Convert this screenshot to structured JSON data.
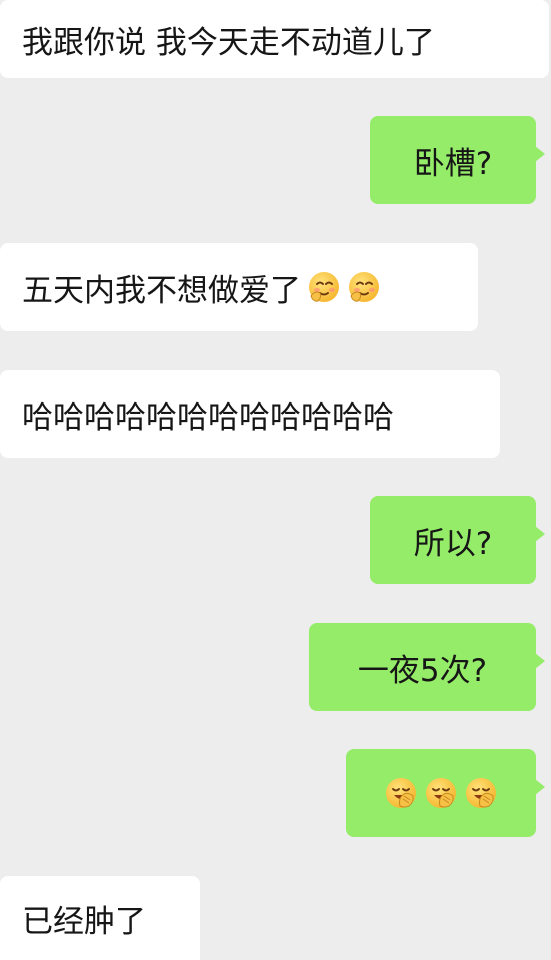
{
  "chat": {
    "messages": [
      {
        "side": "in",
        "text": "我跟你说 我今天走不动道儿了"
      },
      {
        "side": "out",
        "text": "卧槽?"
      },
      {
        "side": "in",
        "text": "五天内我不想做爱了",
        "emojis": [
          "thinking-blush-face-icon",
          "thinking-blush-face-icon"
        ]
      },
      {
        "side": "in",
        "text": "哈哈哈哈哈哈哈哈哈哈哈哈"
      },
      {
        "side": "out",
        "text": "所以?"
      },
      {
        "side": "out",
        "text": "一夜5次?"
      },
      {
        "side": "out",
        "text": "",
        "emojis": [
          "facepalm-grin-face-icon",
          "facepalm-grin-face-icon",
          "facepalm-grin-face-icon"
        ]
      },
      {
        "side": "in",
        "text": "已经肿了"
      }
    ]
  },
  "colors": {
    "background": "#ededed",
    "incoming_bubble": "#ffffff",
    "outgoing_bubble": "#95ec69",
    "text": "#161616"
  }
}
